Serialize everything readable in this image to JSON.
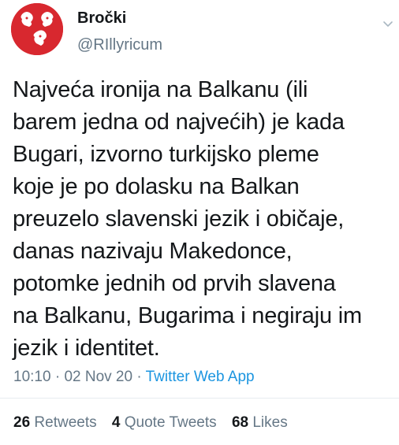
{
  "user": {
    "display_name": "Bročki",
    "handle": "@RIllyricum"
  },
  "tweet": {
    "text": "Najveća ironija na Balkanu (ili\nbarem jedna od najvećih) je kada\nBugari, izvorno turkijsko pleme\nkoje je po dolasku na Balkan\npreuzelo slavenski jezik i običaje,\ndanas nazivaju Makedonce,\npotomke jednih od prvih slavena\nna Balkanu, Bugarima i negiraju im\njezik i identitet."
  },
  "meta": {
    "time": "10:10",
    "sep1": " · ",
    "date": "02 Nov 20",
    "sep2": " · ",
    "app": "Twitter Web App"
  },
  "stats": {
    "retweets_count": "26",
    "retweets_label": "Retweets",
    "quote_count": "4",
    "quote_label": "Quote Tweets",
    "likes_count": "68",
    "likes_label": "Likes"
  },
  "colors": {
    "avatar_bg": "#d8282f",
    "link": "#1b95e0",
    "secondary_text": "#657786"
  },
  "icons": {
    "avatar": "eagle-heads-emblem",
    "menu": "chevron-down-icon"
  }
}
